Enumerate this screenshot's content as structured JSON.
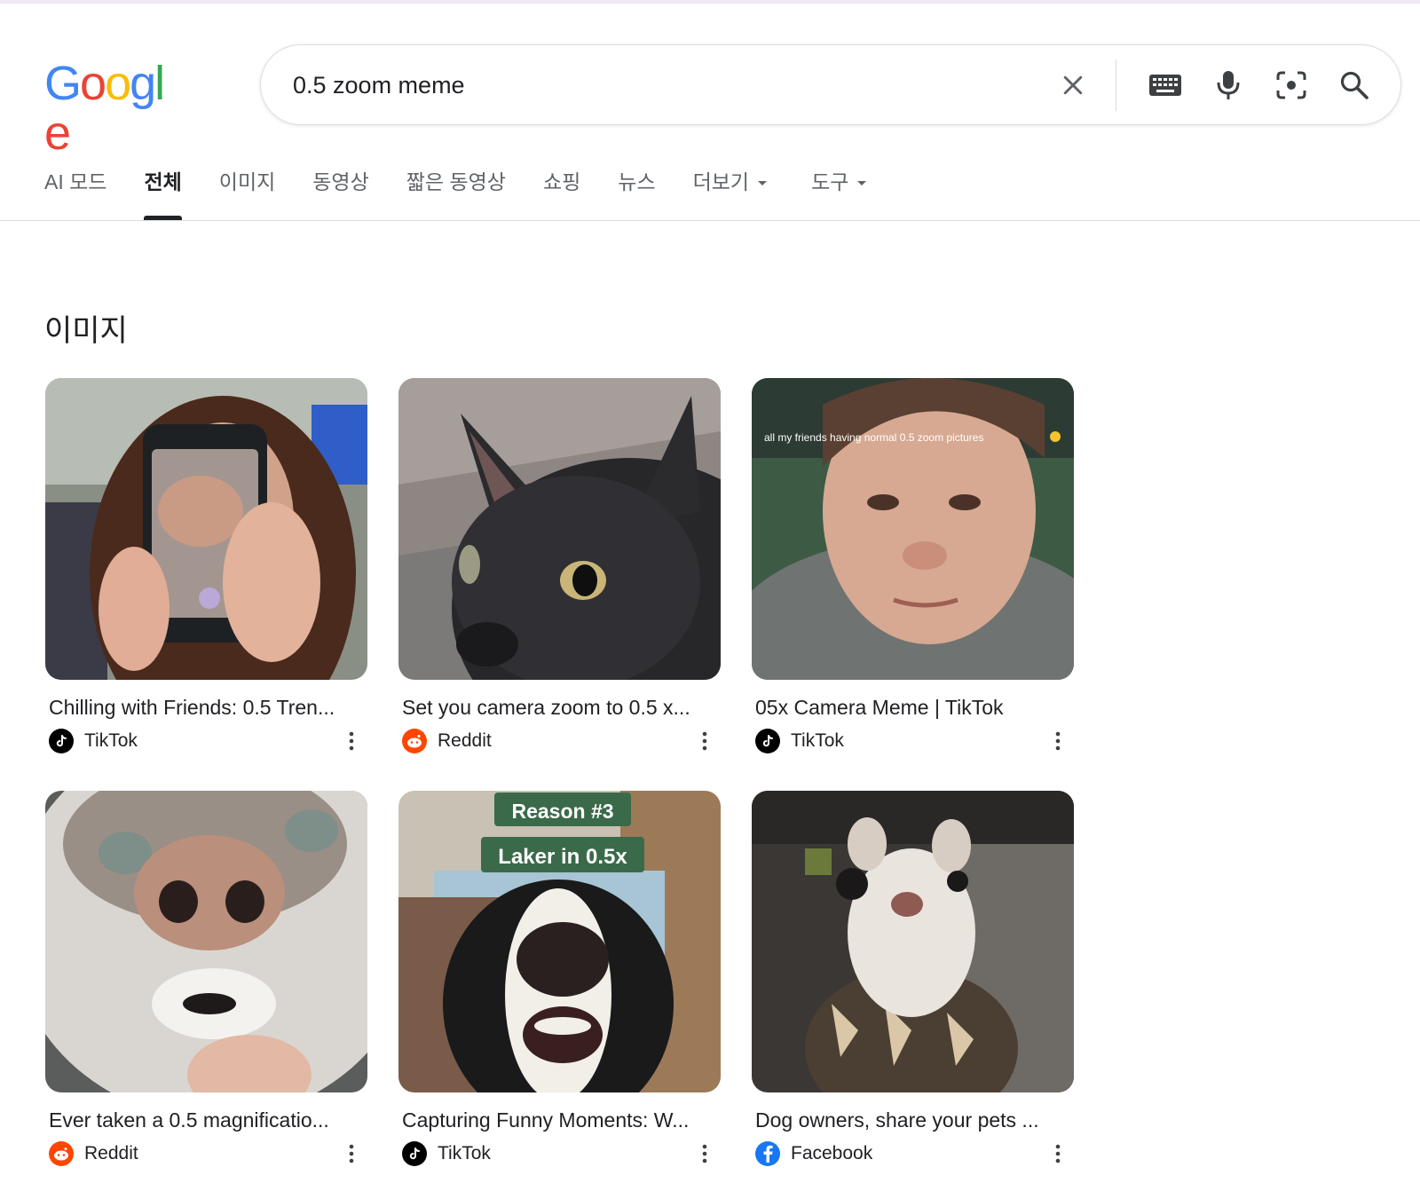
{
  "logo": {
    "letters": [
      "G",
      "o",
      "o",
      "g",
      "l",
      "e"
    ],
    "colors": [
      "#4285F4",
      "#EA4335",
      "#FBBC05",
      "#4285F4",
      "#34A853",
      "#EA4335"
    ]
  },
  "search": {
    "query": "0.5 zoom meme",
    "placeholder": ""
  },
  "search_icons": [
    "close-icon",
    "keyboard-icon",
    "microphone-icon",
    "lens-icon",
    "search-icon"
  ],
  "tabs": [
    {
      "label": "AI 모드",
      "active": false,
      "dropdown": false
    },
    {
      "label": "전체",
      "active": true,
      "dropdown": false
    },
    {
      "label": "이미지",
      "active": false,
      "dropdown": false
    },
    {
      "label": "동영상",
      "active": false,
      "dropdown": false
    },
    {
      "label": "짧은 동영상",
      "active": false,
      "dropdown": false
    },
    {
      "label": "쇼핑",
      "active": false,
      "dropdown": false
    },
    {
      "label": "뉴스",
      "active": false,
      "dropdown": false
    },
    {
      "label": "더보기",
      "active": false,
      "dropdown": true
    },
    {
      "label": "도구",
      "active": false,
      "dropdown": true
    }
  ],
  "images_section": {
    "title": "이미지",
    "results": [
      {
        "title": "Chilling with Friends: 0.5 Tren...",
        "source": "TikTok",
        "favicon": "tiktok-icon"
      },
      {
        "title": "Set you camera zoom to 0.5 x...",
        "source": "Reddit",
        "favicon": "reddit-icon"
      },
      {
        "title": "05x Camera Meme | TikTok",
        "source": "TikTok",
        "favicon": "tiktok-icon",
        "overlay_text": "all my friends having normal 0.5 zoom pictures"
      },
      {
        "title": "Ever taken a 0.5 magnificatio...",
        "source": "Reddit",
        "favicon": "reddit-icon"
      },
      {
        "title": "Capturing Funny Moments: W...",
        "source": "TikTok",
        "favicon": "tiktok-icon",
        "overlay_lines": [
          "Reason #3",
          "Laker in 0.5x"
        ]
      },
      {
        "title": "Dog owners, share your pets ...",
        "source": "Facebook",
        "favicon": "facebook-icon"
      }
    ]
  }
}
